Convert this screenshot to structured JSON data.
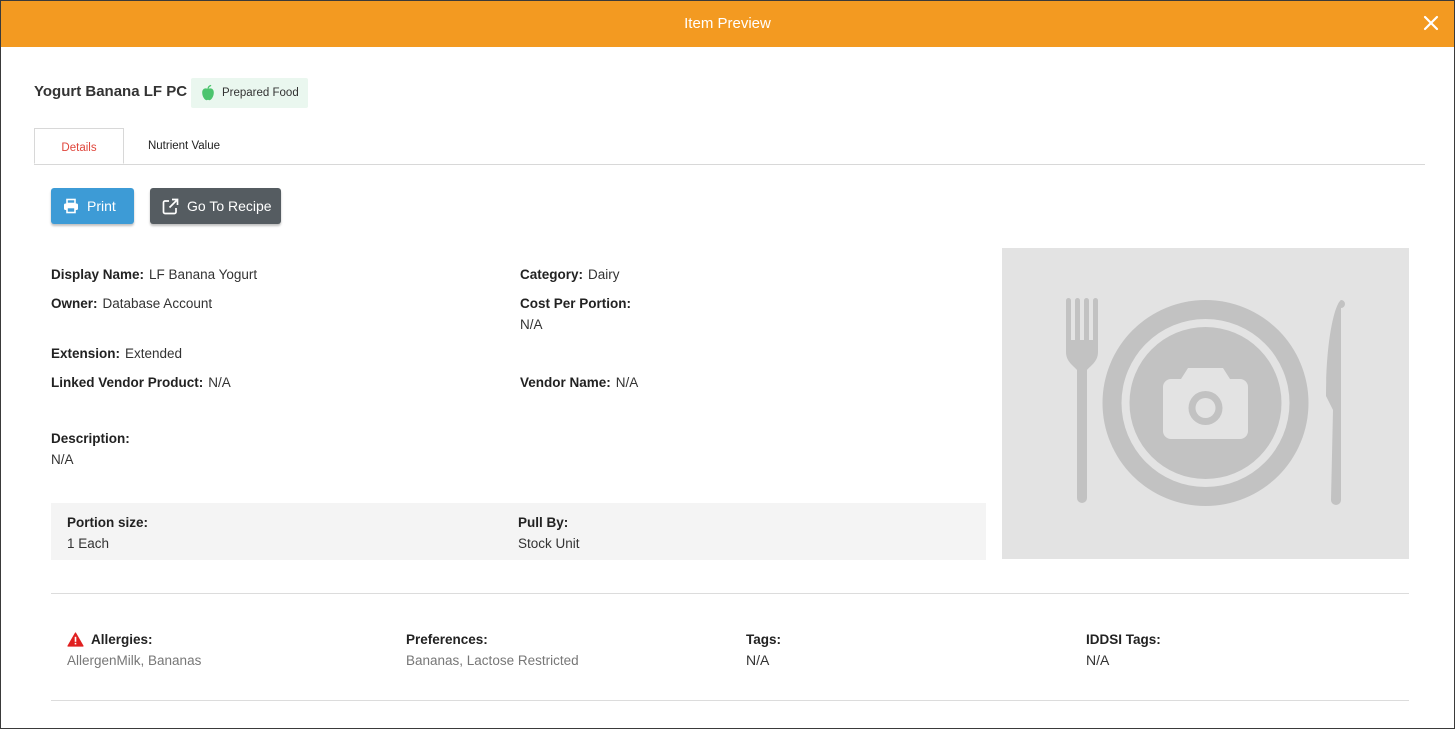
{
  "header": {
    "title": "Item Preview"
  },
  "item": {
    "name": "Yogurt Banana LF PC",
    "type_badge": "Prepared Food"
  },
  "tabs": [
    {
      "label": "Details",
      "active": true
    },
    {
      "label": "Nutrient Value",
      "active": false
    }
  ],
  "actions": {
    "print_label": "Print",
    "recipe_label": "Go To Recipe"
  },
  "fields": {
    "display_name": {
      "label": "Display Name:",
      "value": "LF Banana Yogurt"
    },
    "category": {
      "label": "Category:",
      "value": "Dairy"
    },
    "owner": {
      "label": "Owner:",
      "value": "Database Account"
    },
    "cost_per_portion": {
      "label": "Cost Per Portion:",
      "value": "N/A"
    },
    "extension": {
      "label": "Extension:",
      "value": "Extended"
    },
    "linked_vendor_product": {
      "label": "Linked Vendor Product:",
      "value": "N/A"
    },
    "vendor_name": {
      "label": "Vendor Name:",
      "value": "N/A"
    },
    "description": {
      "label": "Description:",
      "value": "N/A"
    }
  },
  "portion": {
    "portion_size": {
      "label": "Portion size:",
      "value": "1 Each"
    },
    "pull_by": {
      "label": "Pull By:",
      "value": "Stock Unit"
    }
  },
  "meta": {
    "allergies": {
      "label": "Allergies:",
      "value": "AllergenMilk, Bananas"
    },
    "preferences": {
      "label": "Preferences:",
      "value": "Bananas, Lactose Restricted"
    },
    "tags": {
      "label": "Tags:",
      "value": "N/A"
    },
    "iddsi_tags": {
      "label": "IDDSI Tags:",
      "value": "N/A"
    }
  },
  "colors": {
    "header": "#f39a21",
    "print_button": "#3d9bd6",
    "recipe_button": "#555c61",
    "active_tab_text": "#e0463c",
    "allergy_icon": "#e02020",
    "badge_icon": "#4cc46e"
  },
  "icons": {
    "close": "close-icon",
    "badge": "apple-icon",
    "print": "printer-icon",
    "recipe": "external-link-icon",
    "placeholder": "plate-camera-placeholder-icon",
    "allergy": "warning-icon"
  }
}
